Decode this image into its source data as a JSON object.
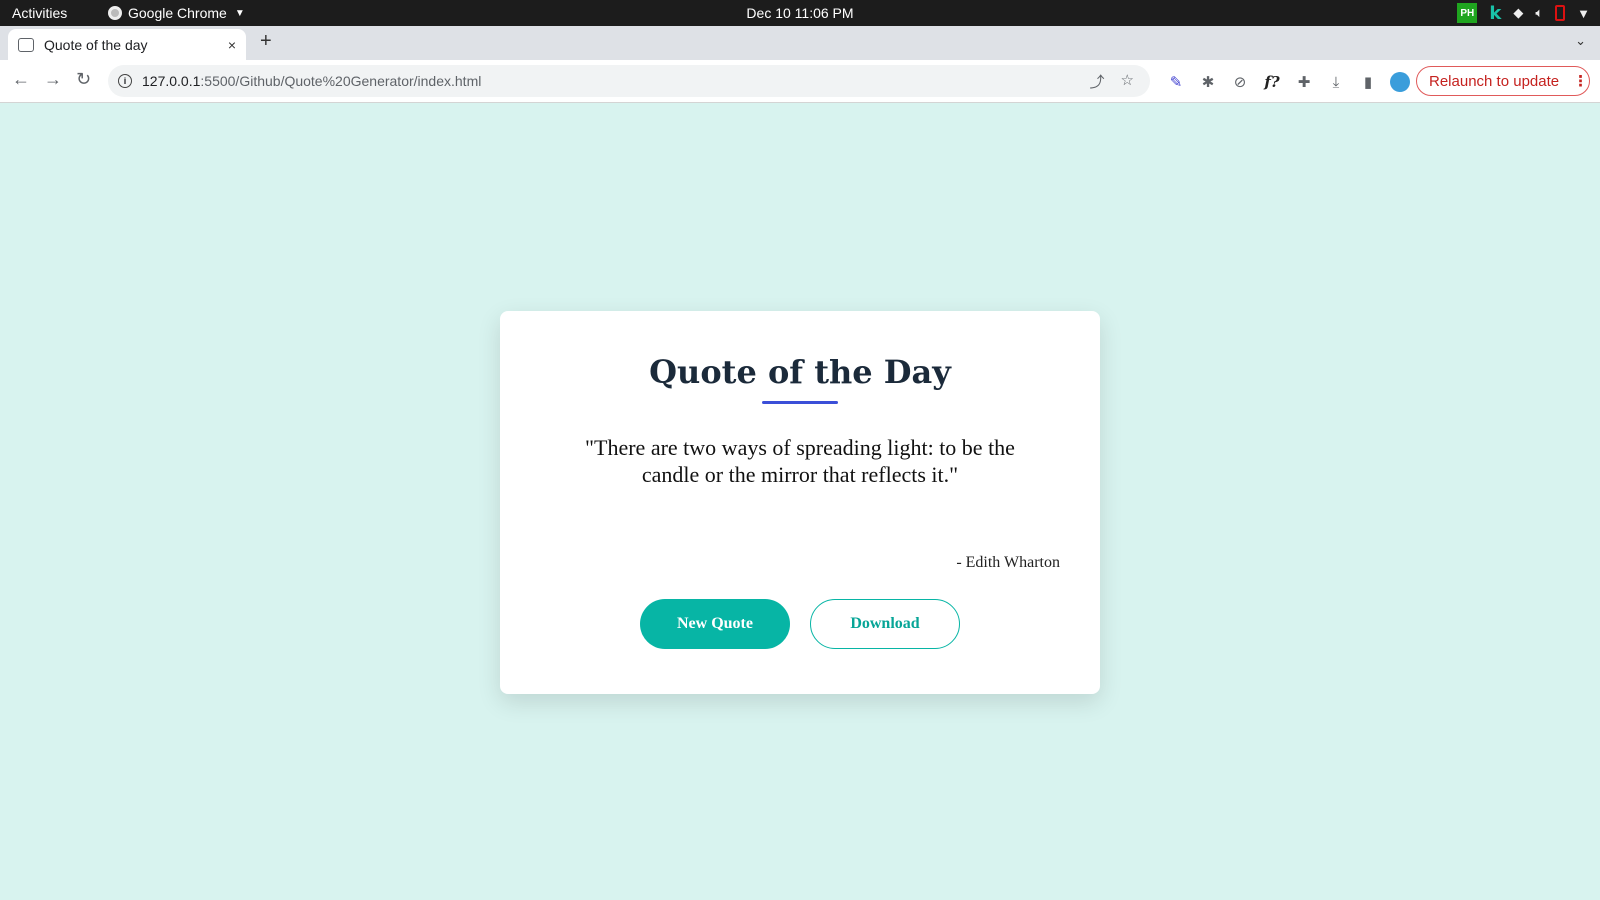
{
  "topbar": {
    "activities": "Activities",
    "app_name": "Google Chrome",
    "clock": "Dec 10  11:06 PM",
    "tray_ph": "PH",
    "tray_k": "k"
  },
  "tab": {
    "title": "Quote of the day",
    "close": "×",
    "new_tab": "+"
  },
  "toolbar": {
    "url_host": "127.0.0.1",
    "url_rest": ":5500/Github/Quote%20Generator/index.html",
    "relaunch_label": "Relaunch to update",
    "extension_f": "f?"
  },
  "card": {
    "title": "Quote of the Day",
    "quote": "\"There are two ways of spreading light: to be the candle or the mirror that reflects it.\"",
    "author": "- Edith Wharton",
    "new_quote_label": "New Quote",
    "download_label": "Download"
  },
  "colors": {
    "page_background": "#d8f3ef",
    "accent": "#07b5a5",
    "title_underline": "#3b4fd8"
  }
}
